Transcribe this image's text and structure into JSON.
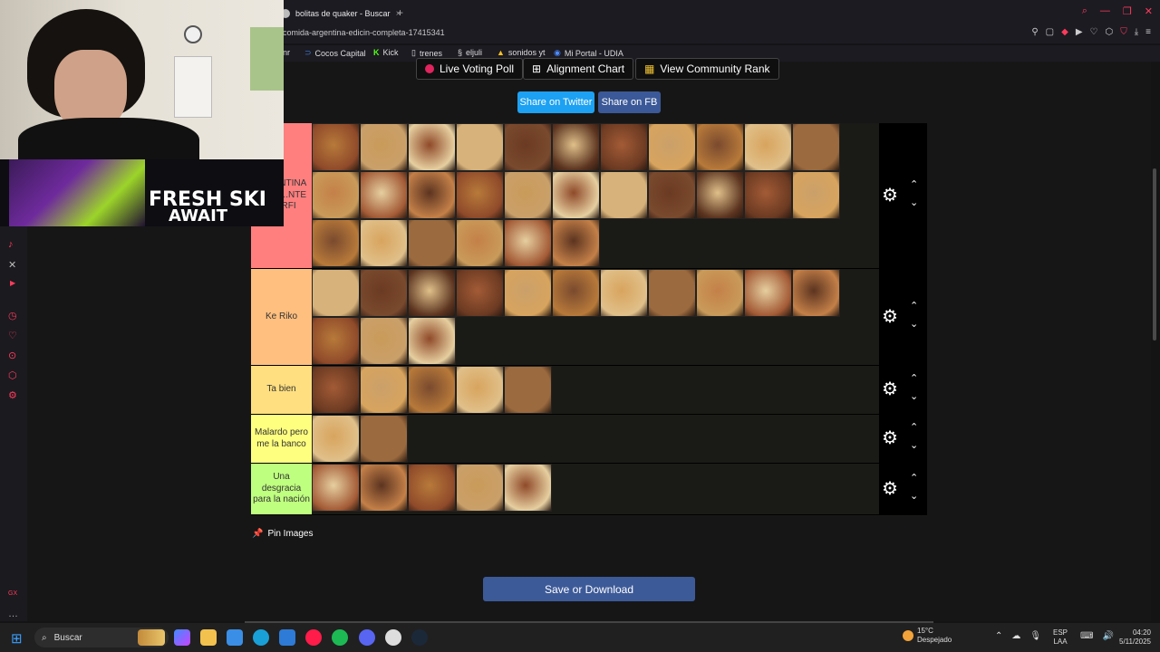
{
  "browser": {
    "tab_title": "bolitas de quaker - Buscar",
    "url": "comida-argentina-edicin-completa-17415341",
    "bookmarks": [
      {
        "label": "nr",
        "icon": "bookmark-icon"
      },
      {
        "label": "Cocos Capital",
        "icon": "cocos-icon"
      },
      {
        "label": "Kick",
        "icon": "kick-icon"
      },
      {
        "label": "trenes",
        "icon": "page-icon"
      },
      {
        "label": "eljuli",
        "icon": "s-icon"
      },
      {
        "label": "sonidos yt",
        "icon": "triangle-icon"
      },
      {
        "label": "Mi Portal - UDIA",
        "icon": "udia-icon"
      }
    ]
  },
  "top_buttons": {
    "live_poll": "Live Voting Poll",
    "alignment_chart": "Alignment Chart",
    "community_rank": "View Community Rank"
  },
  "share": {
    "twitter": "Share on Twitter",
    "fb": "Share on FB"
  },
  "tiers": [
    {
      "label": "...A ...NTINA ...OO ...NTE ...ORFI",
      "color": "#ff7f7f",
      "items": 28
    },
    {
      "label": "Ke Riko",
      "color": "#ffbf7f",
      "items": 14
    },
    {
      "label": "Ta bien",
      "color": "#ffdf7f",
      "items": 5
    },
    {
      "label": "Malardo pero me la banco",
      "color": "#ffff7f",
      "items": 2
    },
    {
      "label": "Una desgracia para la nación",
      "color": "#bfff7f",
      "items": 5
    }
  ],
  "pin_images": "Pin Images",
  "save_button": "Save or Download",
  "webcam_banner": {
    "line1": "FRESH SKI",
    "line2": "AWAIT"
  },
  "taskbar": {
    "search_label": "Buscar",
    "temperature": "15°C",
    "weather": "Despejado",
    "lang1": "ESP",
    "lang2": "LAA",
    "time": "04:20",
    "date": "5/11/2025"
  },
  "colors": {
    "accent": "#3d5a98",
    "twitter": "#1da1f2",
    "facebook": "#3b5998",
    "browser_accent": "#ff3b5c"
  }
}
